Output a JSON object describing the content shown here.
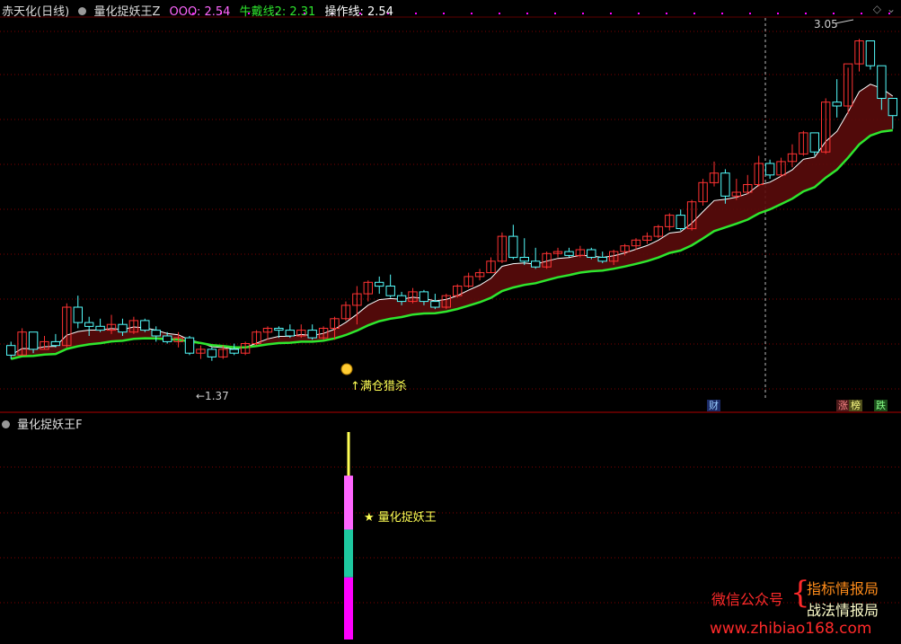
{
  "top_panel": {
    "stock_name": "赤天化(日线)",
    "indicator_name": "量化捉妖王Z",
    "ooo_label": "OOO: 2.54",
    "bull_label": "牛戴线2: 2.31",
    "op_label": "操作线: 2.54",
    "high_label": "3.05",
    "low_label": "←1.37",
    "signal_label": "↑满仓猎杀",
    "tags": {
      "cai": "财",
      "zhang": "涨",
      "bang": "榜",
      "die": "跌"
    }
  },
  "bottom_panel": {
    "indicator_name": "量化捉妖王F",
    "signal_label": "★ 量化捉妖王"
  },
  "watermark": {
    "wechat": "微信公众号",
    "name1": "指标情报局",
    "name2": "战法情报局",
    "url": "www.zhibiao168.com"
  },
  "colors": {
    "up": "#ff3232",
    "down": "#54fcfc",
    "bull_line": "#2ee62e",
    "op_line": "#ffffff",
    "band_fill": "#5a0b0b",
    "grid": "#800000",
    "pink": "#ff66ff",
    "yellow": "#ffff54",
    "magenta": "#ff00ff"
  },
  "chart_data": [
    {
      "type": "candlestick",
      "title": "赤天化(日线)",
      "ylim": [
        1.2,
        3.15
      ],
      "candles": [
        [
          1.45,
          1.47,
          1.38,
          1.4
        ],
        [
          1.4,
          1.54,
          1.4,
          1.52
        ],
        [
          1.52,
          1.52,
          1.41,
          1.43
        ],
        [
          1.43,
          1.5,
          1.43,
          1.47
        ],
        [
          1.47,
          1.51,
          1.44,
          1.45
        ],
        [
          1.45,
          1.67,
          1.44,
          1.65
        ],
        [
          1.65,
          1.71,
          1.54,
          1.57
        ],
        [
          1.57,
          1.6,
          1.5,
          1.55
        ],
        [
          1.55,
          1.59,
          1.52,
          1.53
        ],
        [
          1.53,
          1.61,
          1.51,
          1.56
        ],
        [
          1.56,
          1.59,
          1.5,
          1.52
        ],
        [
          1.52,
          1.6,
          1.51,
          1.58
        ],
        [
          1.58,
          1.59,
          1.52,
          1.53
        ],
        [
          1.53,
          1.55,
          1.47,
          1.5
        ],
        [
          1.5,
          1.52,
          1.46,
          1.47
        ],
        [
          1.47,
          1.52,
          1.44,
          1.49
        ],
        [
          1.49,
          1.5,
          1.4,
          1.41
        ],
        [
          1.41,
          1.45,
          1.38,
          1.43
        ],
        [
          1.43,
          1.44,
          1.37,
          1.39
        ],
        [
          1.39,
          1.45,
          1.38,
          1.43
        ],
        [
          1.43,
          1.46,
          1.4,
          1.41
        ],
        [
          1.41,
          1.47,
          1.4,
          1.46
        ],
        [
          1.46,
          1.53,
          1.45,
          1.52
        ],
        [
          1.52,
          1.55,
          1.48,
          1.54
        ],
        [
          1.54,
          1.55,
          1.49,
          1.53
        ],
        [
          1.53,
          1.56,
          1.49,
          1.5
        ],
        [
          1.5,
          1.56,
          1.49,
          1.53
        ],
        [
          1.53,
          1.56,
          1.48,
          1.49
        ],
        [
          1.49,
          1.55,
          1.48,
          1.54
        ],
        [
          1.54,
          1.6,
          1.48,
          1.59
        ],
        [
          1.59,
          1.68,
          1.58,
          1.66
        ],
        [
          1.66,
          1.76,
          1.56,
          1.72
        ],
        [
          1.72,
          1.79,
          1.68,
          1.78
        ],
        [
          1.78,
          1.81,
          1.72,
          1.76
        ],
        [
          1.76,
          1.82,
          1.7,
          1.71
        ],
        [
          1.71,
          1.73,
          1.66,
          1.68
        ],
        [
          1.68,
          1.75,
          1.67,
          1.73
        ],
        [
          1.73,
          1.74,
          1.66,
          1.68
        ],
        [
          1.68,
          1.72,
          1.64,
          1.65
        ],
        [
          1.65,
          1.72,
          1.64,
          1.71
        ],
        [
          1.71,
          1.77,
          1.7,
          1.76
        ],
        [
          1.76,
          1.83,
          1.75,
          1.81
        ],
        [
          1.81,
          1.85,
          1.79,
          1.83
        ],
        [
          1.83,
          1.91,
          1.83,
          1.89
        ],
        [
          1.89,
          2.04,
          1.88,
          2.02
        ],
        [
          2.02,
          2.08,
          1.9,
          1.91
        ],
        [
          1.91,
          2.01,
          1.87,
          1.89
        ],
        [
          1.89,
          1.96,
          1.85,
          1.86
        ],
        [
          1.86,
          1.94,
          1.85,
          1.93
        ],
        [
          1.93,
          1.96,
          1.91,
          1.94
        ],
        [
          1.94,
          1.96,
          1.91,
          1.92
        ],
        [
          1.92,
          1.97,
          1.91,
          1.95
        ],
        [
          1.95,
          1.96,
          1.9,
          1.91
        ],
        [
          1.91,
          1.94,
          1.88,
          1.89
        ],
        [
          1.89,
          1.95,
          1.87,
          1.94
        ],
        [
          1.94,
          1.98,
          1.92,
          1.97
        ],
        [
          1.97,
          2.01,
          1.95,
          2.0
        ],
        [
          2.0,
          2.04,
          1.98,
          2.02
        ],
        [
          2.02,
          2.08,
          2.01,
          2.07
        ],
        [
          2.07,
          2.14,
          2.05,
          2.13
        ],
        [
          2.13,
          2.16,
          2.05,
          2.06
        ],
        [
          2.06,
          2.21,
          2.05,
          2.2
        ],
        [
          2.2,
          2.32,
          2.18,
          2.3
        ],
        [
          2.3,
          2.41,
          2.28,
          2.35
        ],
        [
          2.35,
          2.37,
          2.19,
          2.23
        ],
        [
          2.23,
          2.32,
          2.21,
          2.25
        ],
        [
          2.25,
          2.34,
          2.24,
          2.29
        ],
        [
          2.29,
          2.44,
          2.28,
          2.4
        ],
        [
          2.4,
          2.42,
          2.32,
          2.34
        ],
        [
          2.34,
          2.43,
          2.33,
          2.41
        ],
        [
          2.41,
          2.5,
          2.38,
          2.45
        ],
        [
          2.45,
          2.57,
          2.44,
          2.56
        ],
        [
          2.56,
          2.55,
          2.44,
          2.46
        ],
        [
          2.46,
          2.74,
          2.45,
          2.72
        ],
        [
          2.72,
          2.84,
          2.64,
          2.7
        ],
        [
          2.7,
          2.9,
          2.66,
          2.92
        ],
        [
          2.92,
          3.05,
          2.88,
          3.04
        ],
        [
          3.04,
          3.02,
          2.89,
          2.91
        ],
        [
          2.91,
          2.84,
          2.68,
          2.74
        ],
        [
          2.74,
          2.72,
          2.58,
          2.65
        ]
      ],
      "series": [
        {
          "name": "操作线",
          "values": []
        },
        {
          "name": "牛戴线2",
          "values": []
        }
      ],
      "annotations": [
        "3.05",
        "←1.37",
        "↑满仓猎杀"
      ]
    },
    {
      "type": "bar",
      "title": "量化捉妖王F",
      "stacked_bar_segments": [
        {
          "color": "magenta",
          "from": 0,
          "to": 0.3
        },
        {
          "color": "cyan",
          "from": 0.3,
          "to": 0.53
        },
        {
          "color": "pink",
          "from": 0.53,
          "to": 0.79
        },
        {
          "color": "yellow",
          "from": 0.79,
          "to": 1.0
        }
      ],
      "annotations": [
        "★ 量化捉妖王"
      ]
    }
  ]
}
